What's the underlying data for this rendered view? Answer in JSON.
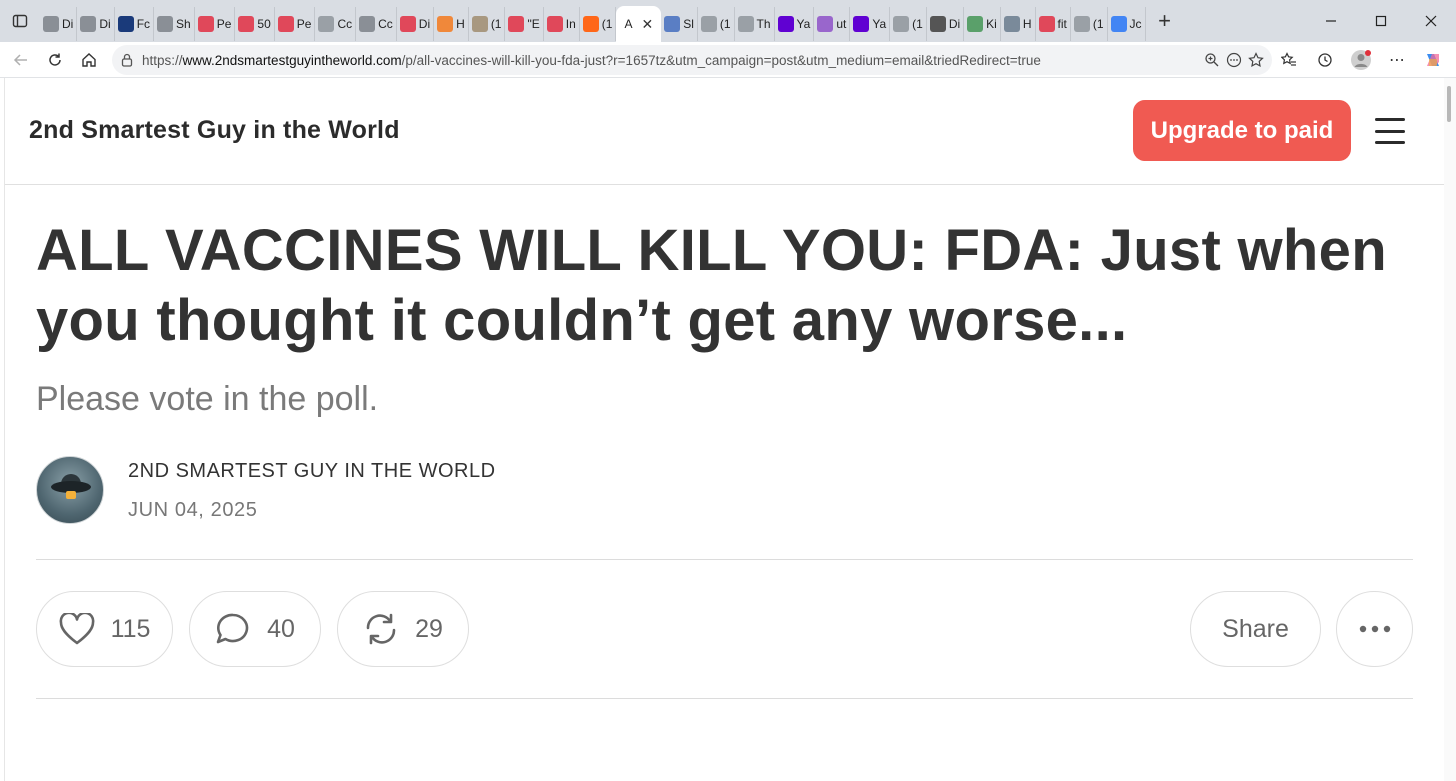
{
  "browser": {
    "tabs": [
      {
        "label": "Di",
        "icon": "globe-icon",
        "color": "#8a8f96"
      },
      {
        "label": "Di",
        "icon": "globe-icon",
        "color": "#8a8f96"
      },
      {
        "label": "Fc",
        "icon": "fox-news-icon",
        "color": "#1a3a7a"
      },
      {
        "label": "Sh",
        "icon": "globe-icon",
        "color": "#8a8f96"
      },
      {
        "label": "Pe",
        "icon": "youtube-icon",
        "color": "#e0485a"
      },
      {
        "label": "50",
        "icon": "youtube-icon",
        "color": "#e0485a"
      },
      {
        "label": "Pe",
        "icon": "youtube-icon",
        "color": "#e0485a"
      },
      {
        "label": "Cc",
        "icon": "seal-icon",
        "color": "#9aa0a6"
      },
      {
        "label": "Cc",
        "icon": "globe-icon",
        "color": "#8a8f96"
      },
      {
        "label": "Di",
        "icon": "youtube-icon",
        "color": "#e0485a"
      },
      {
        "label": "H",
        "icon": "blogger-icon",
        "color": "#f0883a"
      },
      {
        "label": "(1",
        "icon": "image-icon",
        "color": "#a89880"
      },
      {
        "label": "\"E",
        "icon": "youtube-icon",
        "color": "#e0485a"
      },
      {
        "label": "In",
        "icon": "youtube-icon",
        "color": "#e0485a"
      },
      {
        "label": "(1",
        "icon": "substack-icon",
        "color": "#ff6719"
      }
    ],
    "active_tab": {
      "label": "A",
      "icon": "close-icon"
    },
    "tabs_right": [
      {
        "label": "Sl",
        "icon": "m-icon",
        "color": "#5a7ec4"
      },
      {
        "label": "(1",
        "icon": "image-icon",
        "color": "#9aa0a6"
      },
      {
        "label": "Th",
        "icon": "gp-icon",
        "color": "#9aa0a6"
      },
      {
        "label": "Ya",
        "icon": "yahoo-icon",
        "color": "#6001d2"
      },
      {
        "label": "ut",
        "icon": "yahoo-icon",
        "color": "#9966cc"
      },
      {
        "label": "Ya",
        "icon": "yahoo-icon",
        "color": "#6001d2"
      },
      {
        "label": "(1",
        "icon": "fp-icon",
        "color": "#9aa0a6"
      },
      {
        "label": "Di",
        "icon": "dd-icon",
        "color": "#555555"
      },
      {
        "label": "Ki",
        "icon": "image-icon",
        "color": "#5aa06a"
      },
      {
        "label": "H",
        "icon": "image-icon",
        "color": "#7a8a9a"
      },
      {
        "label": "fit",
        "icon": "youtube-icon",
        "color": "#e0485a"
      },
      {
        "label": "(1",
        "icon": "fp-icon",
        "color": "#9aa0a6"
      },
      {
        "label": "Jc",
        "icon": "google-icon",
        "color": "#4285f4"
      }
    ],
    "url_prefix": "https://",
    "url_host": "www.2ndsmartestguyintheworld.com",
    "url_path": "/p/all-vaccines-will-kill-you-fda-just?r=1657tz&utm_campaign=post&utm_medium=email&triedRedirect=true"
  },
  "site": {
    "title": "2nd Smartest Guy in the World",
    "upgrade_label": "Upgrade to paid"
  },
  "post": {
    "title": "ALL VACCINES WILL KILL YOU: FDA: Just when you thought it couldn’t get any worse...",
    "subtitle": "Please vote in the poll.",
    "author": "2ND SMARTEST GUY IN THE WORLD",
    "date": "JUN 04, 2025"
  },
  "actions": {
    "likes": "115",
    "comments": "40",
    "restacks": "29",
    "share_label": "Share"
  }
}
